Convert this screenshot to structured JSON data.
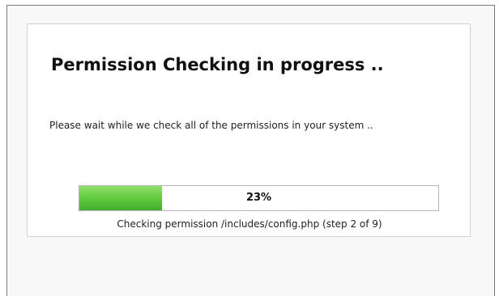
{
  "dialog": {
    "title": "Permission Checking in progress ..",
    "message": "Please wait while we check all of the permissions in your system ..",
    "progress": {
      "value": 0.23,
      "label": "23%"
    },
    "status": "Checking permission /includes/config.php (step 2 of 9)"
  },
  "colors": {
    "progress_fill": "#66cc44",
    "panel_background": "#ffffff",
    "frame_background": "#f8f8f8"
  }
}
